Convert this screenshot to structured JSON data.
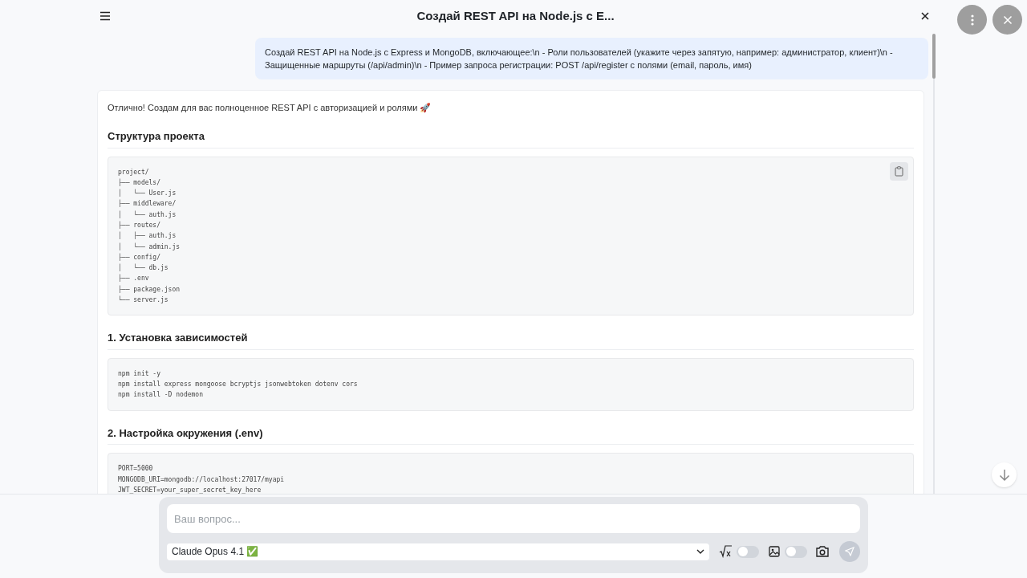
{
  "header": {
    "title": "Создай REST API на Node.js с E..."
  },
  "user_message": "Создай REST API на Node.js с Express и MongoDB, включающее:\\n - Роли пользователей (укажите через запятую, например: администратор, клиент)\\n - Защищенные маршруты (/api/admin)\\n - Пример запроса регистрации: POST /api/register с полями (email, пароль, имя)",
  "answer": {
    "intro": "Отлично! Создам для вас полноценное REST API с авторизацией и ролями 🚀",
    "sections": [
      {
        "heading": "Структура проекта",
        "copyable": true,
        "code": [
          "project/",
          "├── models/",
          "│   └── User.js",
          "├── middleware/",
          "│   └── auth.js",
          "├── routes/",
          "│   ├── auth.js",
          "│   └── admin.js",
          "├── config/",
          "│   └── db.js",
          "├── .env",
          "├── package.json",
          "└── server.js"
        ]
      },
      {
        "heading": "1. Установка зависимостей",
        "copyable": false,
        "code": [
          "npm init -y",
          "npm install express mongoose bcryptjs jsonwebtoken dotenv cors",
          "npm install -D nodemon"
        ]
      },
      {
        "heading": "2. Настройка окружения (.env)",
        "copyable": false,
        "code": [
          "PORT=5000",
          "MONGODB_URI=mongodb://localhost:27017/myapi",
          "JWT_SECRET=your_super_secret_key_here"
        ]
      }
    ]
  },
  "composer": {
    "placeholder": "Ваш вопрос...",
    "model": "Claude Opus 4.1 ✅",
    "toggles": [
      {
        "kind": "formula",
        "on": false
      },
      {
        "kind": "image",
        "on": false
      }
    ],
    "send_disabled": true
  }
}
